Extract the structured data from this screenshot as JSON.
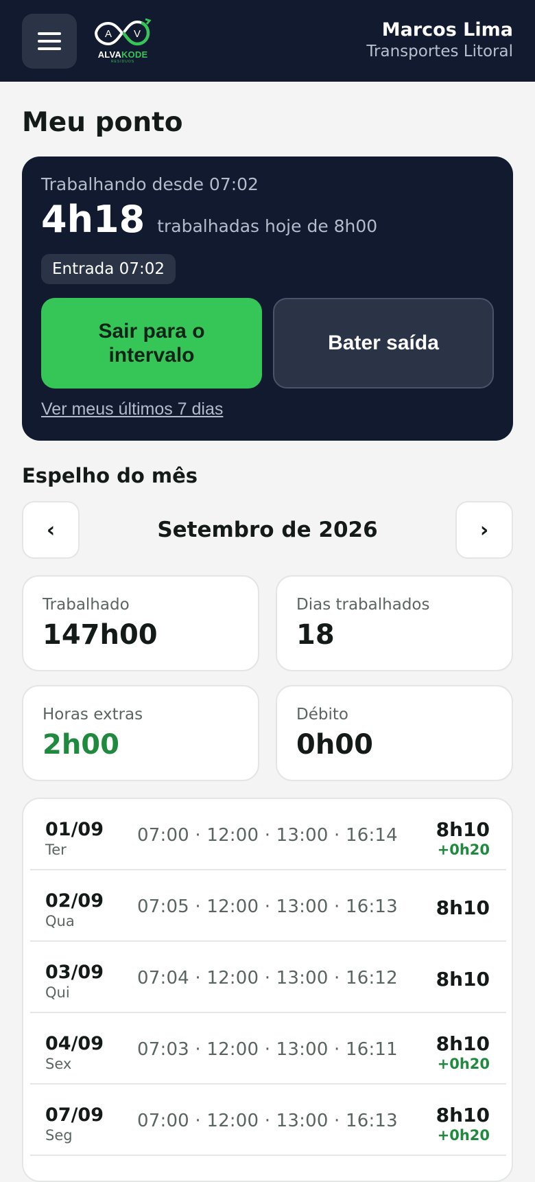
{
  "header": {
    "logo_brand_part1": "ALVA",
    "logo_brand_part2": "KODE",
    "logo_subtitle": "RESÍDUOS",
    "user_name": "Marcos Lima",
    "company": "Transportes Litoral"
  },
  "page_title": "Meu ponto",
  "status_card": {
    "since": "Trabalhando desde 07:02",
    "worked_today": "4h18",
    "worked_suffix": "trabalhadas hoje de 8h00",
    "entry_chip": "Entrada 07:02",
    "break_button": "Sair para o intervalo",
    "out_button": "Bater saída",
    "last_days_link": "Ver meus últimos 7 dias"
  },
  "month_section": {
    "title": "Espelho do mês",
    "prev": "‹",
    "next": "›",
    "month": "Setembro de 2026"
  },
  "stats": [
    {
      "label": "Trabalhado",
      "value": "147h00"
    },
    {
      "label": "Dias trabalhados",
      "value": "18"
    },
    {
      "label": "Horas extras",
      "value": "2h00"
    },
    {
      "label": "Débito",
      "value": "0h00"
    }
  ],
  "days": [
    {
      "date": "01/09",
      "weekday": "Ter",
      "times": "07:00 · 12:00 · 13:00 · 16:14",
      "total": "8h10",
      "extra": "+0h20"
    },
    {
      "date": "02/09",
      "weekday": "Qua",
      "times": "07:05 · 12:00 · 13:00 · 16:13",
      "total": "8h10",
      "extra": ""
    },
    {
      "date": "03/09",
      "weekday": "Qui",
      "times": "07:04 · 12:00 · 13:00 · 16:12",
      "total": "8h10",
      "extra": ""
    },
    {
      "date": "04/09",
      "weekday": "Sex",
      "times": "07:03 · 12:00 · 13:00 · 16:11",
      "total": "8h10",
      "extra": "+0h20"
    },
    {
      "date": "07/09",
      "weekday": "Seg",
      "times": "07:00 · 12:00 · 13:00 · 16:13",
      "total": "8h10",
      "extra": "+0h20"
    }
  ],
  "colors": {
    "navy": "#111a2e",
    "accent_green": "#36c557",
    "positive_green": "#1f8a3e",
    "background": "#f3f4f3"
  }
}
